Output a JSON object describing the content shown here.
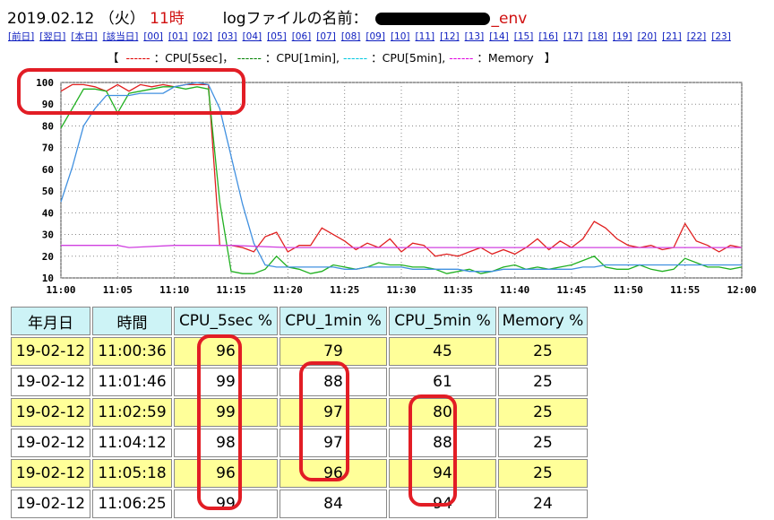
{
  "header": {
    "date": "2019.02.12",
    "weekday": "（火）",
    "hour": "11時",
    "log_label": "logファイルの名前：",
    "log_suffix": "_env"
  },
  "nav_links": [
    "[前日]",
    "[翌日]",
    "[本日]",
    "[該当日]",
    "[00]",
    "[01]",
    "[02]",
    "[03]",
    "[04]",
    "[05]",
    "[06]",
    "[07]",
    "[08]",
    "[09]",
    "[10]",
    "[11]",
    "[12]",
    "[13]",
    "[14]",
    "[15]",
    "[16]",
    "[17]",
    "[18]",
    "[19]",
    "[20]",
    "[21]",
    "[22]",
    "[23]"
  ],
  "legend": {
    "open": "【",
    "close": "】",
    "items": [
      {
        "dash": "------",
        "label": "：CPU[5sec]，",
        "color": "#e00000"
      },
      {
        "dash": "------",
        "label": "：CPU[1min],",
        "color": "#008000"
      },
      {
        "dash": "------",
        "label": "：CPU[5min],",
        "color": "#00c8e0"
      },
      {
        "dash": "------",
        "label": "：Memory",
        "color": "#e000e0"
      }
    ]
  },
  "chart_data": {
    "type": "line",
    "x_ticks": [
      "11:00",
      "11:05",
      "11:10",
      "11:15",
      "11:20",
      "11:25",
      "11:30",
      "11:35",
      "11:40",
      "11:45",
      "11:50",
      "11:55",
      "12:00"
    ],
    "x_range_minutes": [
      0,
      60
    ],
    "ylim": [
      10,
      100
    ],
    "y_ticks": [
      10,
      20,
      30,
      40,
      50,
      60,
      70,
      80,
      90,
      100
    ],
    "grid": true,
    "series": [
      {
        "name": "CPU[5sec]",
        "color": "#e02020",
        "x": [
          0,
          1,
          2,
          3,
          4,
          5,
          6,
          7,
          8,
          9,
          10,
          11,
          12,
          13,
          14,
          15,
          16,
          17,
          18,
          19,
          20,
          21,
          22,
          23,
          24,
          25,
          26,
          27,
          28,
          29,
          30,
          31,
          32,
          33,
          34,
          35,
          36,
          37,
          38,
          39,
          40,
          41,
          42,
          43,
          44,
          45,
          46,
          47,
          48,
          49,
          50,
          51,
          52,
          53,
          54,
          55,
          56,
          57,
          58,
          59,
          60
        ],
        "y": [
          96,
          99,
          99,
          98,
          96,
          99,
          96,
          99,
          98,
          99,
          98,
          99,
          99,
          99,
          25,
          25,
          24,
          22,
          29,
          31,
          22,
          25,
          25,
          33,
          30,
          27,
          23,
          26,
          24,
          28,
          22,
          26,
          25,
          20,
          21,
          20,
          22,
          24,
          21,
          23,
          21,
          24,
          28,
          23,
          27,
          24,
          28,
          36,
          33,
          28,
          25,
          24,
          25,
          23,
          24,
          35,
          27,
          25,
          22,
          25,
          24
        ]
      },
      {
        "name": "CPU[1min]",
        "color": "#20b020",
        "x": [
          0,
          1,
          2,
          3,
          4,
          5,
          6,
          7,
          8,
          9,
          10,
          11,
          12,
          13,
          14,
          15,
          16,
          17,
          18,
          19,
          20,
          21,
          22,
          23,
          24,
          25,
          26,
          27,
          28,
          29,
          30,
          31,
          32,
          33,
          34,
          35,
          36,
          37,
          38,
          39,
          40,
          41,
          42,
          43,
          44,
          45,
          46,
          47,
          48,
          49,
          50,
          51,
          52,
          53,
          54,
          55,
          56,
          57,
          58,
          59,
          60
        ],
        "y": [
          79,
          88,
          97,
          97,
          96,
          86,
          95,
          96,
          97,
          98,
          98,
          97,
          98,
          97,
          45,
          13,
          12,
          12,
          14,
          20,
          15,
          14,
          12,
          13,
          16,
          15,
          14,
          15,
          17,
          16,
          16,
          15,
          15,
          14,
          12,
          13,
          14,
          12,
          13,
          15,
          16,
          14,
          15,
          14,
          15,
          16,
          18,
          20,
          15,
          14,
          14,
          16,
          14,
          13,
          14,
          19,
          17,
          15,
          15,
          14,
          15
        ]
      },
      {
        "name": "CPU[5min]",
        "color": "#4090e0",
        "x": [
          0,
          1,
          2,
          3,
          4,
          5,
          6,
          7,
          8,
          9,
          10,
          11,
          12,
          13,
          14,
          15,
          16,
          17,
          18,
          19,
          20,
          21,
          22,
          23,
          24,
          25,
          26,
          27,
          28,
          29,
          30,
          31,
          32,
          33,
          34,
          35,
          36,
          37,
          38,
          39,
          40,
          41,
          42,
          43,
          44,
          45,
          46,
          47,
          48,
          49,
          50,
          51,
          52,
          53,
          54,
          55,
          56,
          57,
          58,
          59,
          60
        ],
        "y": [
          45,
          61,
          80,
          88,
          94,
          94,
          94,
          95,
          95,
          95,
          98,
          99,
          100,
          99,
          88,
          66,
          44,
          26,
          16,
          15,
          15,
          15,
          15,
          15,
          15,
          14,
          14,
          15,
          15,
          15,
          15,
          14,
          14,
          14,
          14,
          14,
          13,
          13,
          13,
          14,
          14,
          14,
          14,
          14,
          14,
          14,
          15,
          15,
          16,
          16,
          16,
          16,
          16,
          16,
          16,
          16,
          16,
          16,
          16,
          16,
          16
        ]
      },
      {
        "name": "Memory",
        "color": "#d040e0",
        "x": [
          0,
          5,
          6,
          10,
          15,
          20,
          25,
          30,
          35,
          40,
          45,
          50,
          55,
          60
        ],
        "y": [
          25,
          25,
          24,
          25,
          25,
          24,
          24,
          24,
          24,
          24,
          24,
          24,
          24,
          24
        ]
      }
    ]
  },
  "table": {
    "headers": [
      "年月日",
      "時間",
      "CPU_5sec %",
      "CPU_1min %",
      "CPU_5min %",
      "Memory %"
    ],
    "rows": [
      [
        "19-02-12",
        "11:00:36",
        "96",
        "79",
        "45",
        "25"
      ],
      [
        "19-02-12",
        "11:01:46",
        "99",
        "88",
        "61",
        "25"
      ],
      [
        "19-02-12",
        "11:02:59",
        "99",
        "97",
        "80",
        "25"
      ],
      [
        "19-02-12",
        "11:04:12",
        "98",
        "97",
        "88",
        "25"
      ],
      [
        "19-02-12",
        "11:05:18",
        "96",
        "96",
        "94",
        "25"
      ],
      [
        "19-02-12",
        "11:06:25",
        "99",
        "84",
        "94",
        "24"
      ]
    ]
  },
  "annotation_color": "#e21d25"
}
